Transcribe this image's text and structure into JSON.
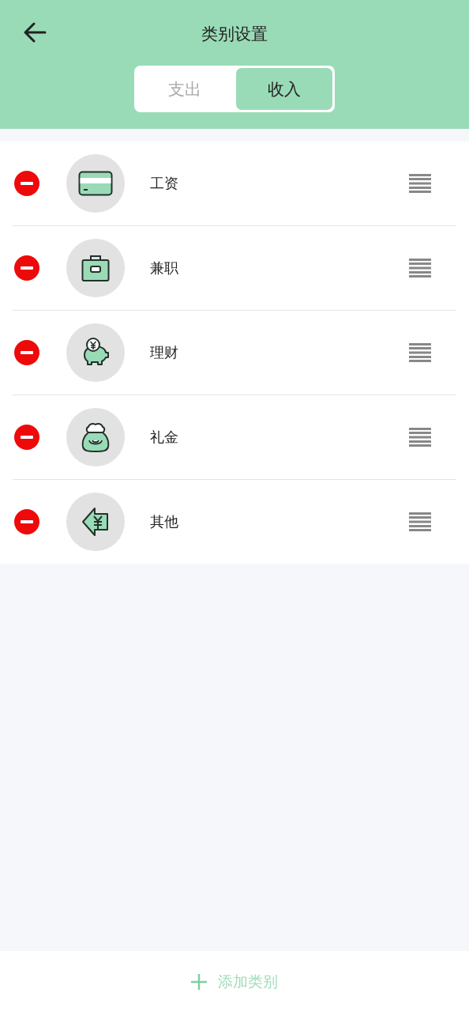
{
  "header": {
    "title": "类别设置"
  },
  "tabs": [
    {
      "label": "支出",
      "selected": false
    },
    {
      "label": "收入",
      "selected": true
    }
  ],
  "categories": [
    {
      "name": "工资",
      "kind": "card"
    },
    {
      "name": "兼职",
      "kind": "briefcase"
    },
    {
      "name": "理财",
      "kind": "piggy"
    },
    {
      "name": "礼金",
      "kind": "bag"
    },
    {
      "name": "其他",
      "kind": "arrow"
    }
  ],
  "footer": {
    "label": "添加类别"
  }
}
